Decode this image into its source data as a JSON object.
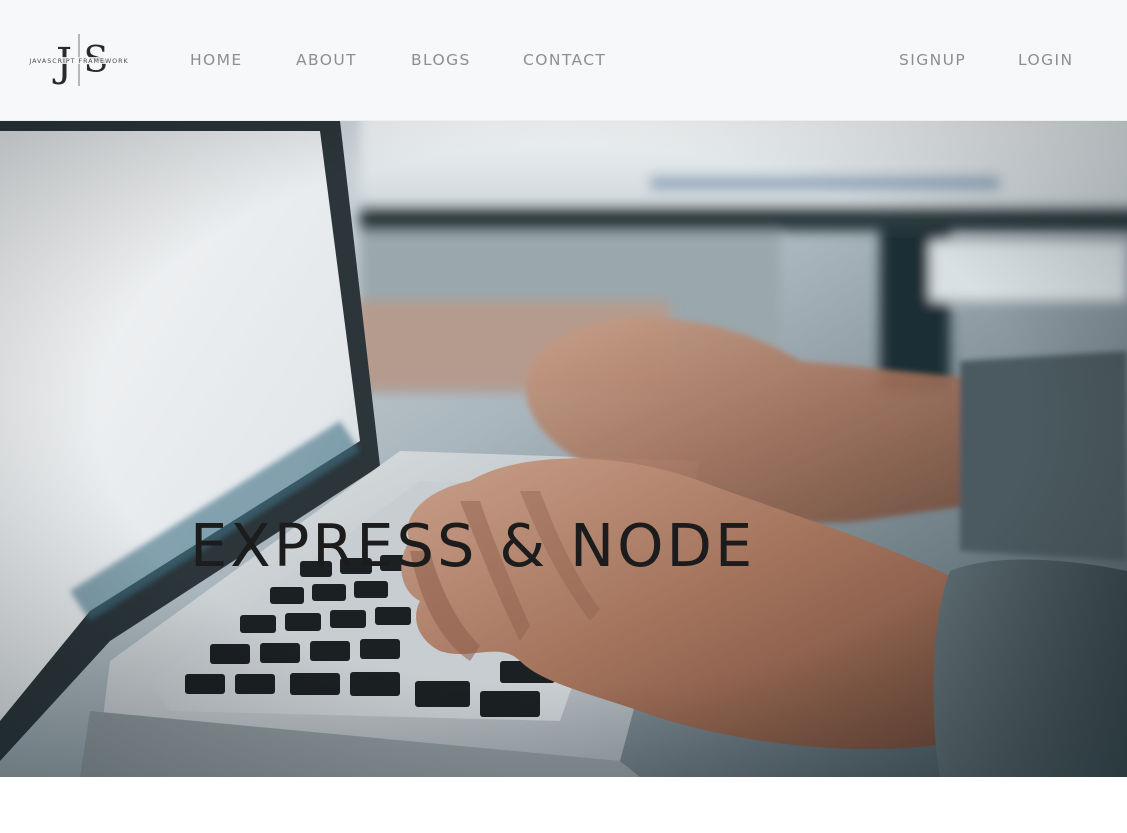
{
  "logo": {
    "monogram_left": "J",
    "monogram_right": "S",
    "tagline": "JAVASCRIPT FRAMEWORK"
  },
  "nav": {
    "home": "HOME",
    "about": "ABOUT",
    "blogs": "BLOGS",
    "contact": "CONTACT",
    "signup": "SIGNUP",
    "login": "LOGIN"
  },
  "hero": {
    "title": "EXPRESS & NODE",
    "image": "person-typing-on-laptop-photo"
  },
  "colors": {
    "navbar_bg": "#f7f8fa",
    "nav_text": "#8e8e8e",
    "hero_title": "#1c1c1c"
  }
}
